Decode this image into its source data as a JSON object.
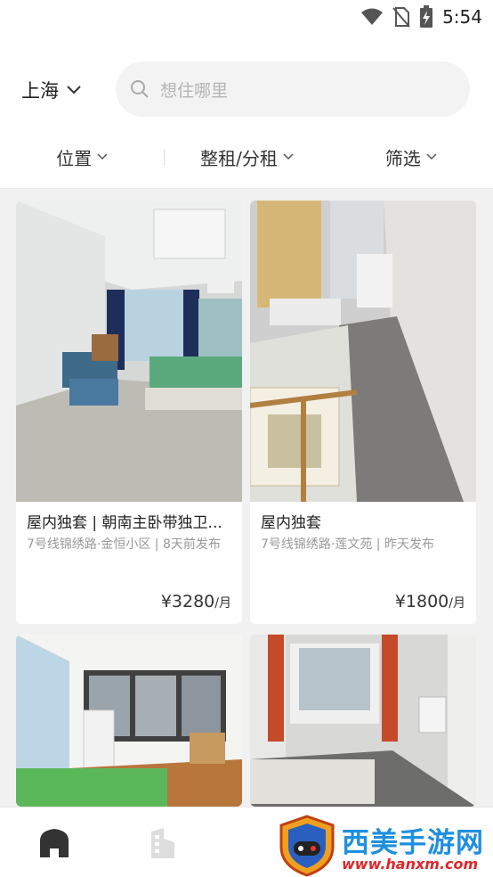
{
  "status_bar": {
    "time": "5:54"
  },
  "header": {
    "city": "上海",
    "search_placeholder": "想住哪里"
  },
  "filters": [
    {
      "label": "位置"
    },
    {
      "label": "整租/分租"
    },
    {
      "label": "筛选"
    }
  ],
  "listings": [
    {
      "title": "屋内独套 | 朝南主卧带独卫...",
      "location": "7号线锦绣路·金恒小区 | 8天前发布",
      "price": "¥3280",
      "unit": "/月"
    },
    {
      "title": "屋内独套",
      "location": "7号线锦绣路·莲文苑 | 昨天发布",
      "price": "¥1800",
      "unit": "/月"
    }
  ],
  "bottom_nav": [
    {
      "icon": "home-icon",
      "active": true
    },
    {
      "icon": "building-icon",
      "active": false
    }
  ],
  "watermark": {
    "brand": "西美手游网",
    "url": "www.hanxm.com"
  },
  "colors": {
    "accent": "#222222",
    "muted": "#999999",
    "background": "#f1f1f1"
  }
}
